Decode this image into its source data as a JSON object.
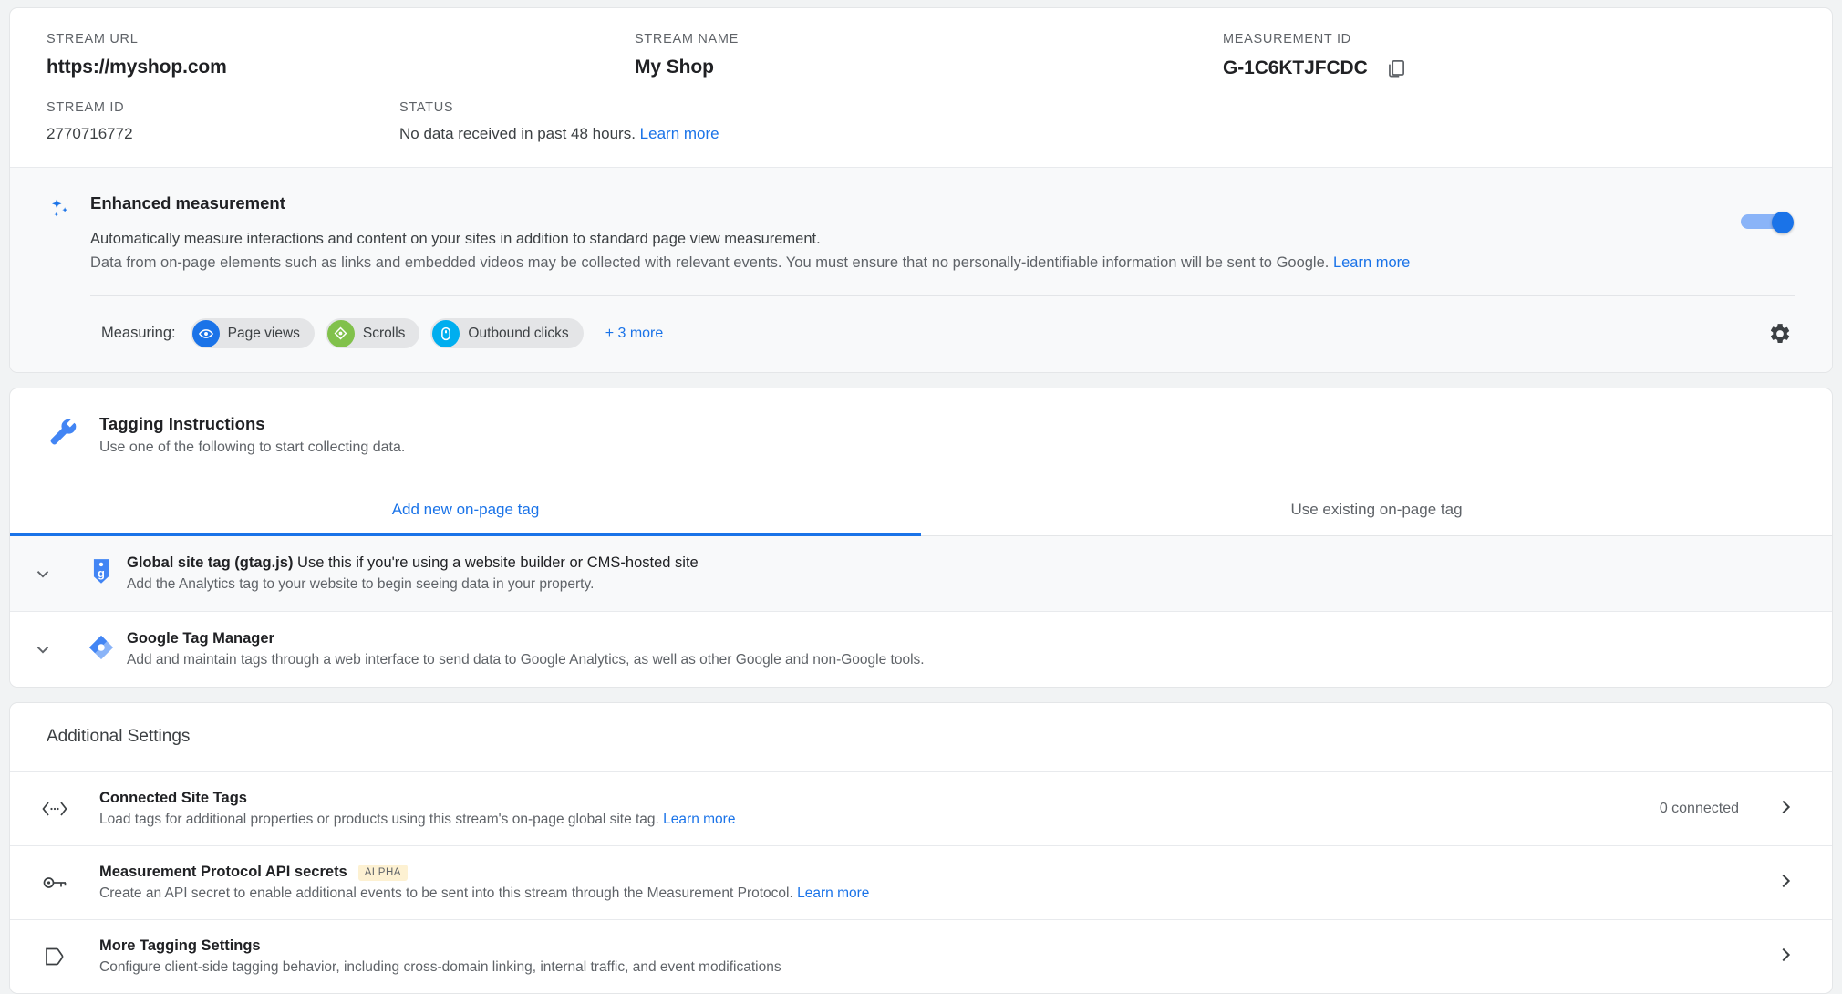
{
  "stream": {
    "url_label": "STREAM URL",
    "url_value": "https://myshop.com",
    "name_label": "STREAM NAME",
    "name_value": "My Shop",
    "measurement_id_label": "MEASUREMENT ID",
    "measurement_id_value": "G-1C6KTJFCDC",
    "stream_id_label": "STREAM ID",
    "stream_id_value": "2770716772",
    "status_label": "STATUS",
    "status_value": "No data received in past 48 hours.",
    "status_link": "Learn more"
  },
  "enhanced_measurement": {
    "title": "Enhanced measurement",
    "desc1": "Automatically measure interactions and content on your sites in addition to standard page view measurement.",
    "desc2": "Data from on-page elements such as links and embedded videos may be collected with relevant events. You must ensure that no personally-identifiable information will be sent to Google.",
    "desc2_link": "Learn more",
    "toggle_on": true,
    "measuring_label": "Measuring:",
    "chips": [
      {
        "label": "Page views",
        "icon": "eye-icon",
        "color": "#1a73e8"
      },
      {
        "label": "Scrolls",
        "icon": "scroll-diamond-icon",
        "color": "#81c14b"
      },
      {
        "label": "Outbound clicks",
        "icon": "mouse-icon",
        "color": "#00aeef"
      }
    ],
    "more_link": "+ 3 more"
  },
  "tagging": {
    "title": "Tagging Instructions",
    "subtitle": "Use one of the following to start collecting data.",
    "tabs": [
      {
        "label": "Add new on-page tag",
        "active": true
      },
      {
        "label": "Use existing on-page tag",
        "active": false
      }
    ],
    "rows": [
      {
        "title": "Global site tag (gtag.js)",
        "title_suffix": " Use this if you're using a website builder or CMS-hosted site",
        "desc": "Add the Analytics tag to your website to begin seeing data in your property.",
        "icon": "gtag-tag-icon"
      },
      {
        "title": "Google Tag Manager",
        "title_suffix": "",
        "desc": "Add and maintain tags through a web interface to send data to Google Analytics, as well as other Google and non-Google tools.",
        "icon": "gtm-diamond-icon"
      }
    ]
  },
  "additional_settings": {
    "heading": "Additional Settings",
    "rows": [
      {
        "title": "Connected Site Tags",
        "badge": "",
        "desc": "Load tags for additional properties or products using this stream's on-page global site tag.",
        "desc_link": "Learn more",
        "right_value": "0 connected",
        "icon": "code-brackets-icon"
      },
      {
        "title": "Measurement Protocol API secrets",
        "badge": "ALPHA",
        "desc": "Create an API secret to enable additional events to be sent into this stream through the Measurement Protocol.",
        "desc_link": "Learn more",
        "right_value": "",
        "icon": "key-icon"
      },
      {
        "title": "More Tagging Settings",
        "badge": "",
        "desc": "Configure client-side tagging behavior, including cross-domain linking, internal traffic, and event modifications",
        "desc_link": "",
        "right_value": "",
        "icon": "tag-outline-icon"
      }
    ]
  },
  "colors": {
    "accent": "#1a73e8",
    "link": "#1a73e8",
    "badge_bg": "#fdf1d2"
  }
}
